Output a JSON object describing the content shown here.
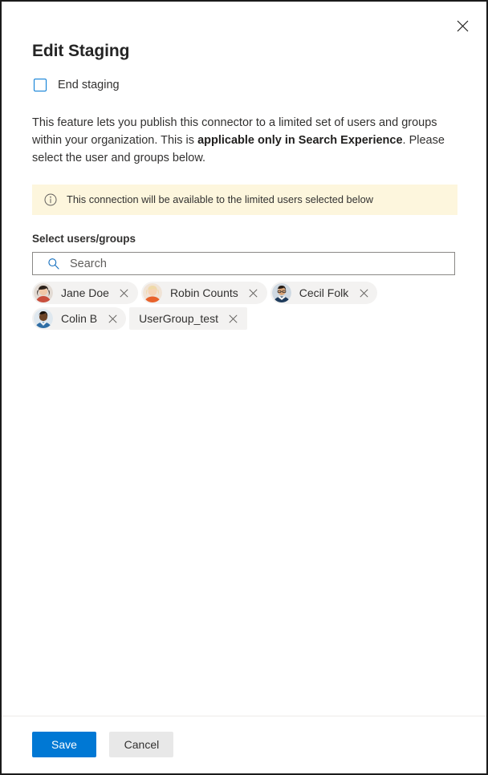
{
  "panel": {
    "title": "Edit Staging",
    "close_icon": "close-icon"
  },
  "end_staging": {
    "label": "End staging",
    "checked": false
  },
  "description": {
    "part1": "This feature lets you publish this connector to a limited set of users and groups within your organization. This is ",
    "bold": "applicable only in Search Experience",
    "part2": ". Please select the user and groups below."
  },
  "info_bar": {
    "icon": "info-circle-icon",
    "text": "This connection will be available to the limited users selected below",
    "background_color": "#fdf6dd"
  },
  "people_picker": {
    "label": "Select users/groups",
    "search": {
      "icon": "search-icon",
      "placeholder": "Search",
      "value": ""
    },
    "selected": [
      {
        "name": "Jane Doe",
        "type": "person",
        "remove_icon": "close-icon"
      },
      {
        "name": "Robin Counts",
        "type": "person",
        "remove_icon": "close-icon"
      },
      {
        "name": "Cecil Folk",
        "type": "person",
        "remove_icon": "close-icon"
      },
      {
        "name": "Colin B",
        "type": "person",
        "remove_icon": "close-icon"
      },
      {
        "name": "UserGroup_test",
        "type": "group",
        "remove_icon": "close-icon"
      }
    ]
  },
  "footer": {
    "save_label": "Save",
    "cancel_label": "Cancel",
    "primary_color": "#0078d4"
  }
}
